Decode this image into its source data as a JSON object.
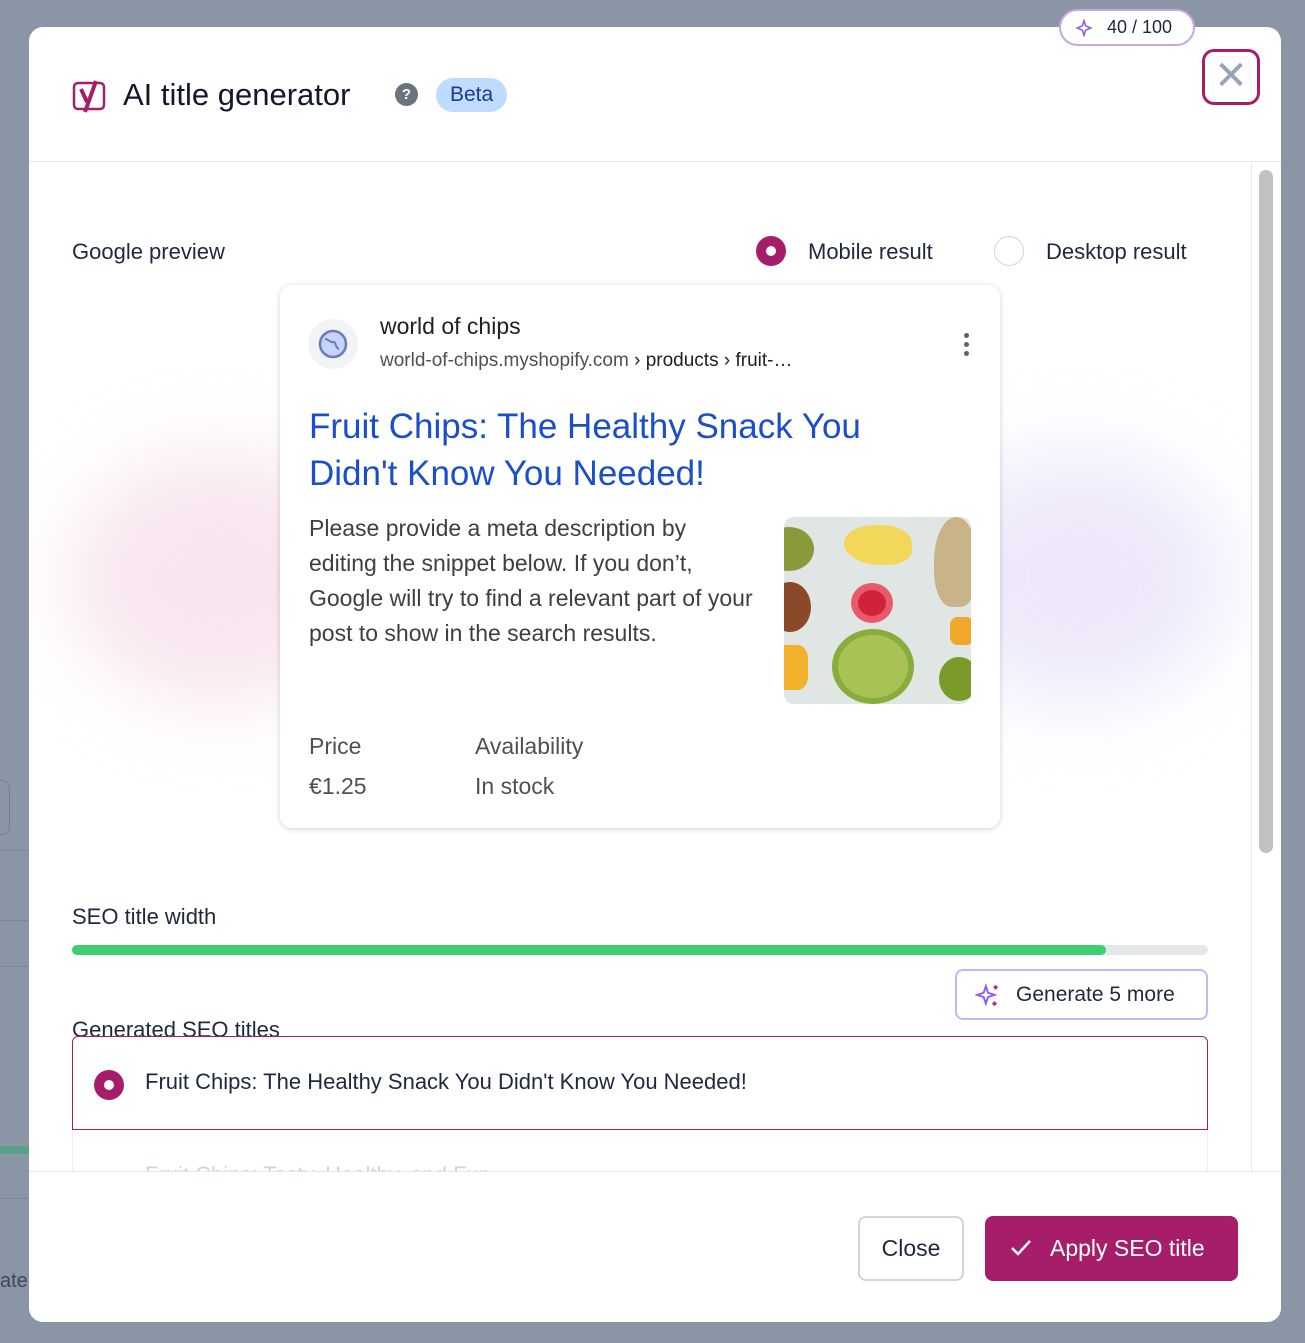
{
  "background": {
    "partial_text": "ate"
  },
  "header": {
    "title": "AI title generator",
    "badge": "Beta",
    "quota": "40 / 100",
    "help_icon": "question-icon",
    "close_icon": "close-icon"
  },
  "preview": {
    "label": "Google preview",
    "modes": [
      {
        "label": "Mobile result",
        "selected": true
      },
      {
        "label": "Desktop result",
        "selected": false
      }
    ],
    "site_name": "world of chips",
    "url_host": "world-of-chips.myshopify.com",
    "url_path": " › products › fruit-…",
    "title": "Fruit Chips: The Healthy Snack You Didn't Know You Needed!",
    "description": "Please provide a meta description by editing the snippet below. If you don’t, Google will try to find a relevant part of your post to show in the search results.",
    "price_label": "Price",
    "price": "€1.25",
    "availability_label": "Availability",
    "availability": "In stock"
  },
  "title_width": {
    "label": "SEO title width",
    "percent": 91,
    "color": "#3ecf6e"
  },
  "generated": {
    "label": "Generated SEO titles",
    "generate_button": "Generate 5 more",
    "options": [
      {
        "text": "Fruit Chips: The Healthy Snack You Didn't Know You Needed!",
        "selected": true
      },
      {
        "text": "Fruit Chips: Tasty, Healthy, and Fun",
        "selected": false
      }
    ]
  },
  "footer": {
    "close": "Close",
    "apply": "Apply SEO title"
  },
  "colors": {
    "accent": "#a61e69",
    "link": "#1a4fc9",
    "beta_bg": "#bfdbfe"
  }
}
